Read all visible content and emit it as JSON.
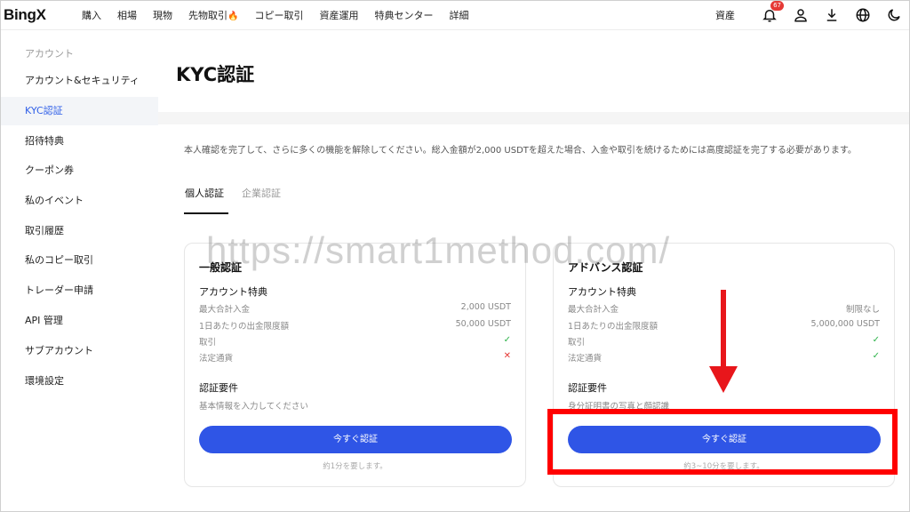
{
  "brand": {
    "name_main": "Bing",
    "name_x": "X"
  },
  "nav": {
    "items": [
      "購入",
      "相場",
      "現物",
      "先物取引",
      "コピー取引",
      "資産運用",
      "特典センター",
      "詳細"
    ],
    "futures_fire": "🔥"
  },
  "toolbar": {
    "assets_label": "資産",
    "notification_count": "67"
  },
  "sidebar": {
    "heading": "アカウント",
    "items": [
      "アカウント&セキュリティ",
      "KYC認証",
      "招待特典",
      "クーポン券",
      "私のイベント",
      "取引履歴",
      "私のコピー取引",
      "トレーダー申請",
      "API 管理",
      "サブアカウント",
      "環境設定"
    ]
  },
  "page": {
    "title": "KYC認証",
    "description": "本人確認を完了して、さらに多くの機能を解除してください。総入金額が2,000 USDTを超えた場合、入金や取引を続けるためには高度認証を完了する必要があります。",
    "tabs": [
      "個人認証",
      "企業認証"
    ]
  },
  "cards": {
    "basic": {
      "title": "一般認証",
      "benefits_title": "アカウント特典",
      "rows": [
        {
          "label": "最大合計入金",
          "value": "2,000 USDT"
        },
        {
          "label": "1日あたりの出金限度額",
          "value": "50,000 USDT"
        },
        {
          "label": "取引",
          "value": "✓"
        },
        {
          "label": "法定通貨",
          "value": "✕"
        }
      ],
      "requirements_title": "認証要件",
      "requirement": "基本情報を入力してください",
      "button": "今すぐ認証",
      "note": "約1分を要します。"
    },
    "advanced": {
      "title": "アドバンス認証",
      "benefits_title": "アカウント特典",
      "rows": [
        {
          "label": "最大合計入金",
          "value": "制限なし"
        },
        {
          "label": "1日あたりの出金限度額",
          "value": "5,000,000 USDT"
        },
        {
          "label": "取引",
          "value": "✓"
        },
        {
          "label": "法定通貨",
          "value": "✓"
        }
      ],
      "requirements_title": "認証要件",
      "requirement": "身分証明書の写真と顔認識",
      "button": "今すぐ認証",
      "note": "約3~10分を要します。"
    }
  },
  "watermark": "https://smart1method.com/",
  "colors": {
    "accent": "#2f55e6",
    "highlight": "#ff0000",
    "ok": "#2eb34a",
    "ng": "#e53935"
  }
}
